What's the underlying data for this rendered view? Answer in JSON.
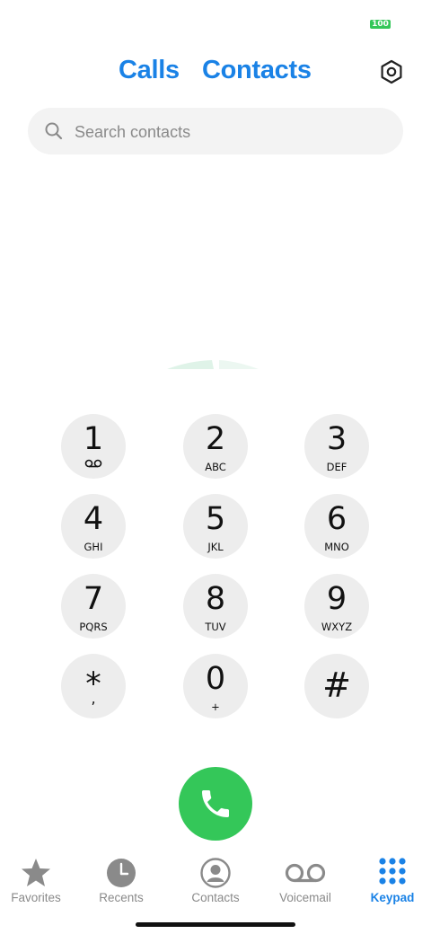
{
  "status_bar": {
    "battery": "100"
  },
  "header": {
    "tabs": [
      {
        "label": "Calls"
      },
      {
        "label": "Contacts"
      }
    ],
    "settings_icon": "settings-hexagon-icon",
    "accent_color": "#1a82e6"
  },
  "search": {
    "placeholder": "Search contacts",
    "value": ""
  },
  "keypad": {
    "keys": [
      {
        "digit": "1",
        "letters": "",
        "sub_icon": "voicemail-icon"
      },
      {
        "digit": "2",
        "letters": "ABC"
      },
      {
        "digit": "3",
        "letters": "DEF"
      },
      {
        "digit": "4",
        "letters": "GHI"
      },
      {
        "digit": "5",
        "letters": "JKL"
      },
      {
        "digit": "6",
        "letters": "MNO"
      },
      {
        "digit": "7",
        "letters": "PQRS"
      },
      {
        "digit": "8",
        "letters": "TUV"
      },
      {
        "digit": "9",
        "letters": "WXYZ"
      },
      {
        "digit": "*",
        "letters": ","
      },
      {
        "digit": "0",
        "letters": "+"
      },
      {
        "digit": "#",
        "letters": ""
      }
    ],
    "key_color": "#ededed"
  },
  "call_button": {
    "icon": "phone-icon",
    "color": "#34c759"
  },
  "bottom_nav": {
    "items": [
      {
        "label": "Favorites",
        "icon": "star-icon"
      },
      {
        "label": "Recents",
        "icon": "clock-icon"
      },
      {
        "label": "Contacts",
        "icon": "person-icon"
      },
      {
        "label": "Voicemail",
        "icon": "voicemail-icon"
      },
      {
        "label": "Keypad",
        "icon": "keypad-icon",
        "active": true
      }
    ],
    "inactive_color": "#8a8a8a",
    "active_color": "#1a82e6"
  }
}
